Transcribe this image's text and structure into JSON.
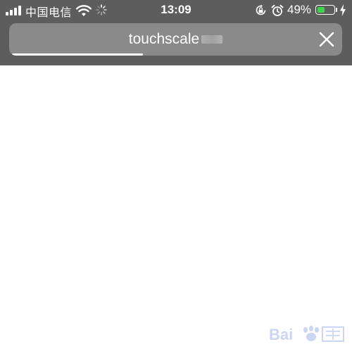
{
  "status_bar": {
    "carrier": "中国电信",
    "time": "13:09",
    "battery_percent": "49%",
    "battery_level": 0.49,
    "battery_color": "#3fd44c",
    "icons": [
      "signal-icon",
      "wifi-icon",
      "loading-spinner-icon",
      "rotation-lock-icon",
      "alarm-icon",
      "battery-icon",
      "charging-icon"
    ]
  },
  "browser": {
    "address_text": "touchscale",
    "close_icon": "close-icon",
    "load_progress": 0.4,
    "bar_color": "#5d5d5d"
  }
}
